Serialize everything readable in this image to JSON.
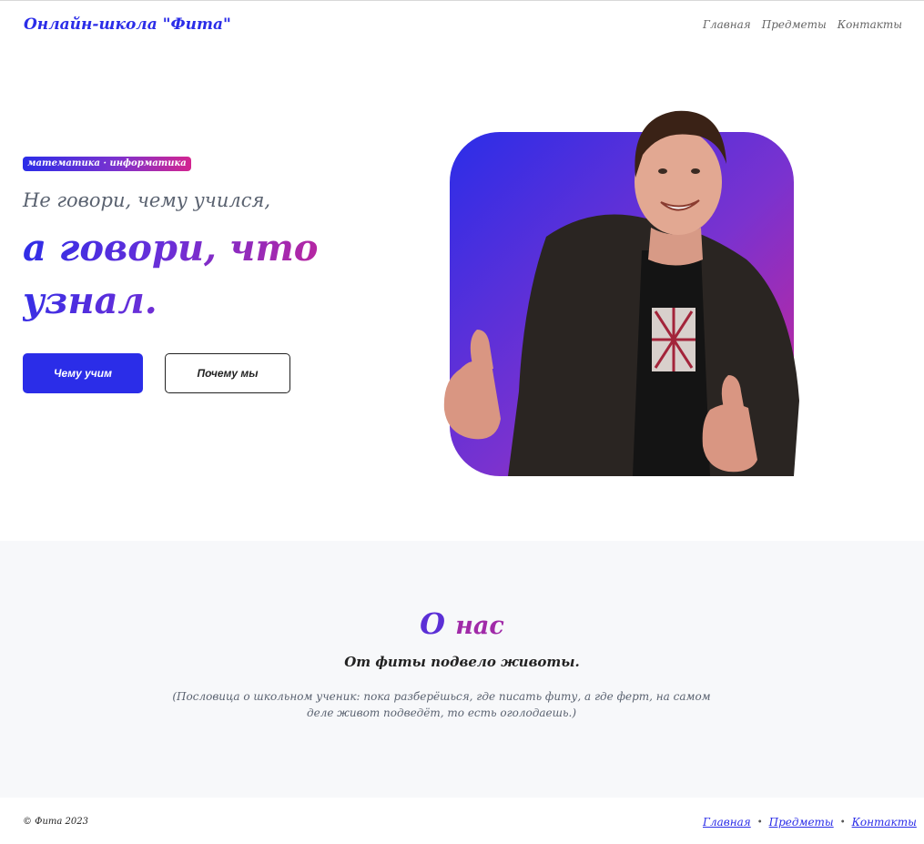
{
  "header": {
    "brand": "Онлайн-школа \"Фита\"",
    "nav": [
      "Главная",
      "Предметы",
      "Контакты"
    ]
  },
  "hero": {
    "badge": "математика · информатика",
    "subheadline": "Не говори, чему учился,",
    "headline": "а говори, что узнал.",
    "buttons": {
      "primary": "Чему учим",
      "secondary": "Почему мы"
    },
    "image_icon": "hero-portrait-image"
  },
  "about": {
    "title_part1": "О",
    "title_part2": "нас",
    "quote": "От фиты подвело животы.",
    "note": "(Пословица о школьном ученик: пока разберёшься, где писать фиту, а где ферт, на самом деле живот подведёт, то есть оголодаешь.)"
  },
  "footer": {
    "copyright": "© Фита 2023",
    "nav": [
      "Главная",
      "Предметы",
      "Контакты"
    ],
    "separator": "•"
  },
  "colors": {
    "accent_blue": "#2b2de8",
    "accent_purple": "#7a32cf",
    "accent_pink": "#d32590",
    "about_bg": "#f7f8fa"
  }
}
